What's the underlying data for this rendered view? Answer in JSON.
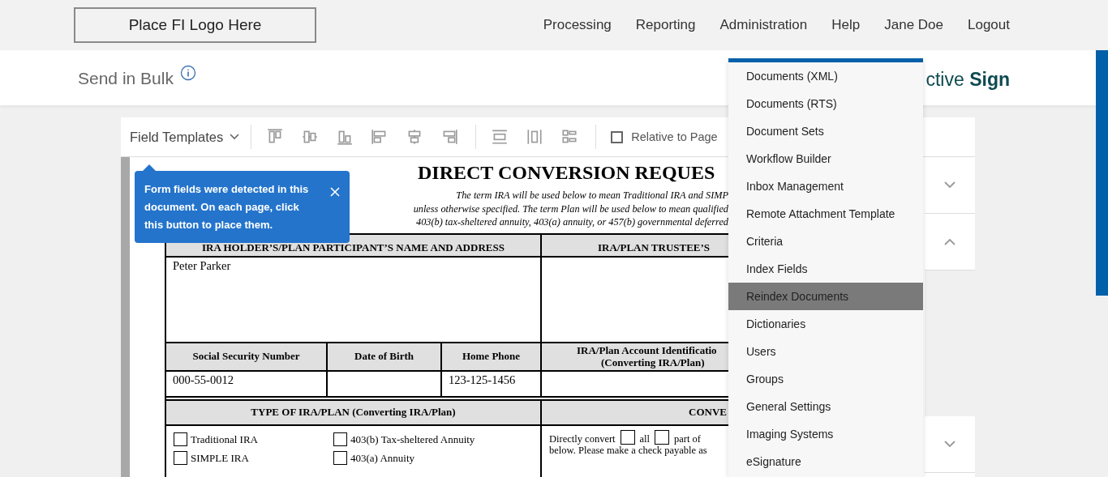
{
  "header": {
    "logo": "Place FI Logo Here",
    "nav": [
      "Processing",
      "Reporting",
      "Administration",
      "Help",
      "Jane Doe",
      "Logout"
    ]
  },
  "subheader": {
    "title": "Send in Bulk",
    "brand": "ctive **Sign**"
  },
  "toolbar": {
    "template_menu": "Field Templates",
    "relative_to_page": {
      "label": "Relative to Page",
      "checked": false
    }
  },
  "tooltip": {
    "text": "Form fields were detected in this document. On each page, click this button to place them."
  },
  "document": {
    "title": "DIRECT CONVERSION REQUES",
    "intro": [
      "The term IRA will be used below to mean Traditional IRA and SIMP",
      "unless otherwise specified. The term Plan will be used below to mean qualified",
      "403(b) tax-sheltered annuity, 403(a) annuity, or 457(b) governmental deferred"
    ],
    "holder_header": "IRA HOLDER’S/PLAN PARTICIPANT’S NAME AND ADDRESS",
    "trustee_header": "IRA/PLAN TRUSTEE’S",
    "holder_name": "Peter Parker",
    "id_columns": [
      {
        "header": "Social Security Number",
        "value": "000-55-0012"
      },
      {
        "header": "Date of Birth"
      },
      {
        "header": "Home Phone",
        "value": "123-125-1456"
      }
    ],
    "account_header": [
      "IRA/Plan Account Identificatio",
      "(Converting IRA/Plan)"
    ],
    "type_header": "TYPE OF IRA/PLAN (Converting IRA/Plan)",
    "conversion_header": "CONVE",
    "plan_types": [
      {
        "label": "Traditional IRA",
        "checked": false
      },
      {
        "label": "403(b) Tax-sheltered Annuity",
        "checked": false
      },
      {
        "label": "SIMPLE IRA",
        "checked": false
      },
      {
        "label": "403(a) Annuity",
        "checked": false
      }
    ],
    "conversion": {
      "prefix": "Directly convert",
      "options": [
        {
          "label": "all",
          "checked": false
        },
        {
          "label": "part of",
          "checked": false
        }
      ],
      "line2": "below. Please make a check payable as"
    }
  },
  "side_panel": {
    "sections": [
      {
        "expanded": false
      },
      {
        "expanded": true
      },
      {
        "expanded": false
      }
    ]
  },
  "dropdown": {
    "items": [
      {
        "label": "Documents (XML)",
        "selected": false
      },
      {
        "label": "Documents (RTS)",
        "selected": false
      },
      {
        "label": "Document Sets",
        "selected": false
      },
      {
        "label": "Workflow Builder",
        "selected": false
      },
      {
        "label": "Inbox Management",
        "selected": false
      },
      {
        "label": "Remote Attachment Template",
        "selected": false
      },
      {
        "label": "Criteria",
        "selected": false
      },
      {
        "label": "Index Fields",
        "selected": false
      },
      {
        "label": "Reindex Documents",
        "selected": true
      },
      {
        "label": "Dictionaries",
        "selected": false
      },
      {
        "label": "Users",
        "selected": false
      },
      {
        "label": "Groups",
        "selected": false
      },
      {
        "label": "General Settings",
        "selected": false
      },
      {
        "label": "Imaging Systems",
        "selected": false
      },
      {
        "label": "eSignature",
        "selected": false
      }
    ]
  }
}
